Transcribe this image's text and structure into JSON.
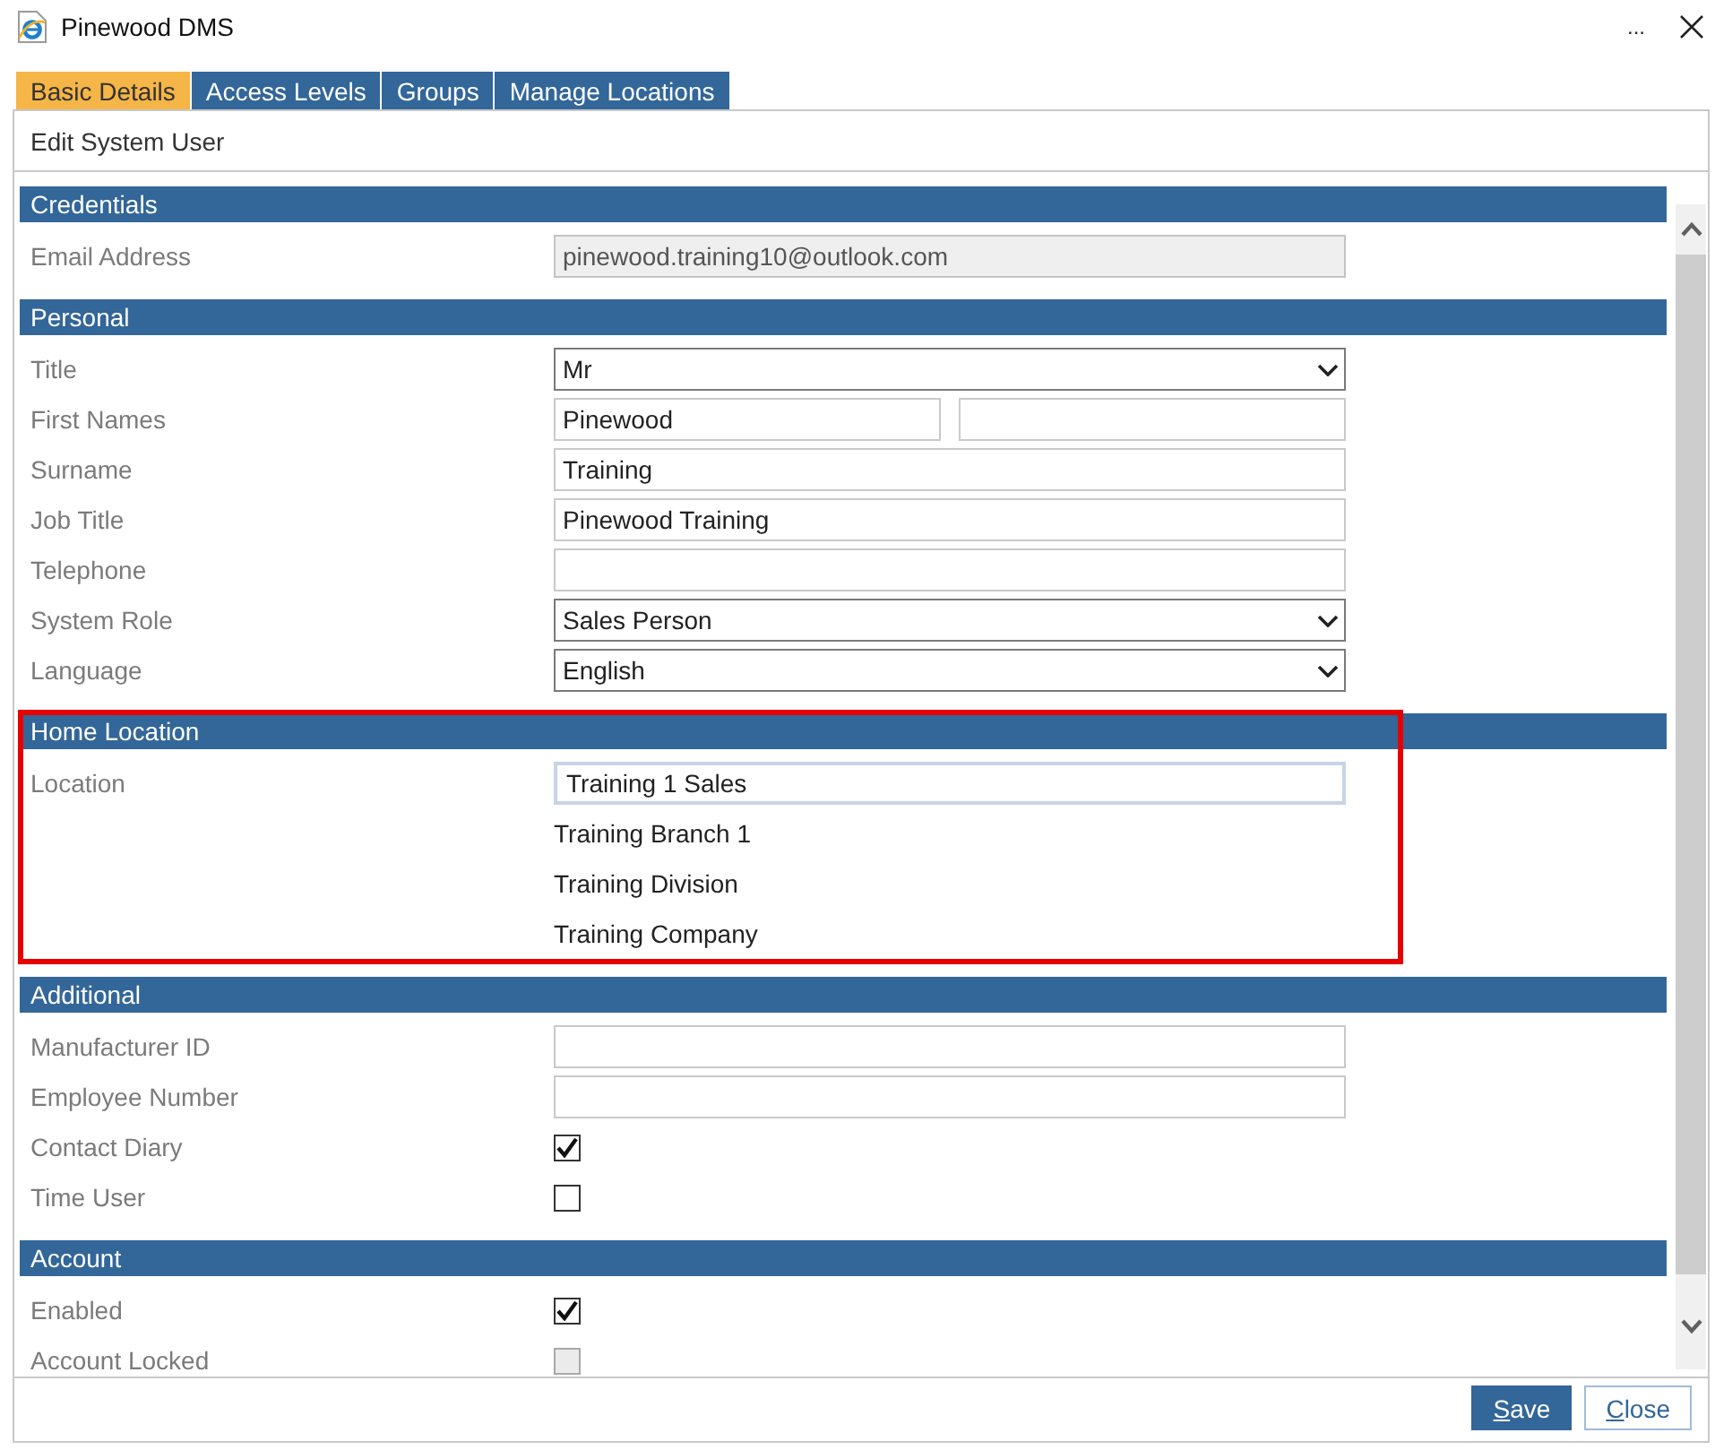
{
  "window": {
    "title": "Pinewood DMS",
    "more": "..."
  },
  "tabs": [
    {
      "label": "Basic Details",
      "selected": true
    },
    {
      "label": "Access Levels",
      "selected": false
    },
    {
      "label": "Groups",
      "selected": false
    },
    {
      "label": "Manage Locations",
      "selected": false
    }
  ],
  "form": {
    "heading": "Edit System User",
    "sections": [
      {
        "title": "Credentials",
        "highlighted": false,
        "rows": [
          {
            "kind": "text",
            "label": "Email Address",
            "value": "pinewood.training10@outlook.com",
            "disabled": true,
            "focused": false
          }
        ]
      },
      {
        "title": "Personal",
        "highlighted": false,
        "rows": [
          {
            "kind": "select",
            "label": "Title",
            "value": "Mr",
            "disabled": false
          },
          {
            "kind": "pair",
            "label": "First Names",
            "value": "Pinewood",
            "disabled": false
          },
          {
            "kind": "text",
            "label": "Surname",
            "value": "Training",
            "disabled": false,
            "focused": false
          },
          {
            "kind": "text",
            "label": "Job Title",
            "value": "Pinewood Training",
            "disabled": false,
            "focused": false
          },
          {
            "kind": "text",
            "label": "Telephone",
            "disabled": false,
            "focused": false
          },
          {
            "kind": "select",
            "label": "System Role",
            "value": "Sales Person",
            "disabled": false
          },
          {
            "kind": "select",
            "label": "Language",
            "value": "English",
            "disabled": false
          }
        ]
      },
      {
        "title": "Home Location",
        "highlighted": true,
        "rows": [
          {
            "kind": "text",
            "label": "Location",
            "value": "Training 1 Sales",
            "disabled": false,
            "focused": true
          },
          {
            "kind": "info",
            "value": "Training Branch 1"
          },
          {
            "kind": "info",
            "value": "Training Division"
          },
          {
            "kind": "info",
            "value": "Training Company"
          }
        ]
      },
      {
        "title": "Additional",
        "highlighted": false,
        "rows": [
          {
            "kind": "text",
            "label": "Manufacturer ID",
            "disabled": false,
            "focused": false
          },
          {
            "kind": "text",
            "label": "Employee Number",
            "disabled": false,
            "focused": false
          },
          {
            "kind": "checkbox",
            "label": "Contact Diary",
            "checked": true,
            "disabled": false
          },
          {
            "kind": "checkbox",
            "label": "Time User",
            "checked": false,
            "disabled": false
          }
        ]
      },
      {
        "title": "Account",
        "highlighted": false,
        "rows": [
          {
            "kind": "checkbox",
            "label": "Enabled",
            "checked": true,
            "disabled": false
          },
          {
            "kind": "checkbox",
            "label": "Account Locked",
            "checked": false,
            "disabled": true
          }
        ]
      }
    ]
  },
  "buttons": [
    {
      "label": "Save",
      "kind": "primary"
    },
    {
      "label": "Close",
      "kind": "secondary"
    }
  ]
}
